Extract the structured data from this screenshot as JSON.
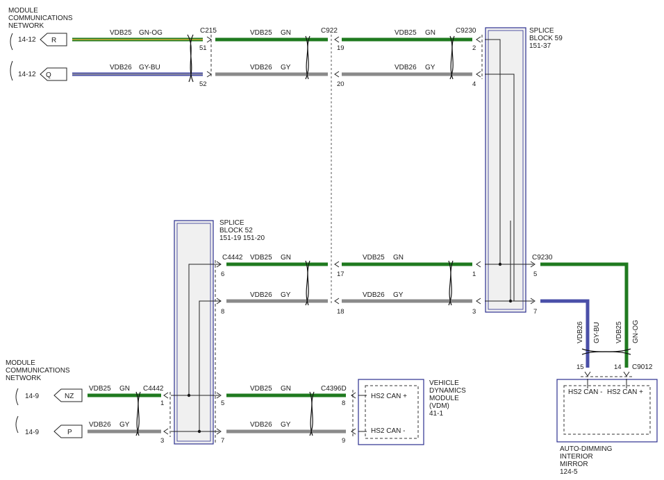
{
  "networks": {
    "top_title": [
      "MODULE",
      "COMMUNICATIONS",
      "NETWORK"
    ],
    "bottom_title": [
      "MODULE",
      "COMMUNICATIONS",
      "NETWORK"
    ],
    "top_refs": [
      "14-12",
      "14-12"
    ],
    "bottom_refs": [
      "14-9",
      "14-9"
    ],
    "top_tags": [
      "R",
      "Q"
    ],
    "bottom_tags": [
      "NZ",
      "P"
    ]
  },
  "wires": {
    "vdb25_gnog": [
      "VDB25",
      "GN-OG"
    ],
    "vdb26_gybu": [
      "VDB26",
      "GY-BU"
    ],
    "vdb25_gn": [
      "VDB25",
      "GN"
    ],
    "vdb26_gy": [
      "VDB26",
      "GY"
    ]
  },
  "connectors": {
    "c215": "C215",
    "c922": "C922",
    "c9230_top": "C9230",
    "c9230_right": "C9230",
    "c4442_mid": "C4442",
    "c4442_bot": "C4442",
    "c4396d": "C4396D",
    "c9012": "C9012"
  },
  "pins": {
    "p51": "51",
    "p52": "52",
    "p19": "19",
    "p20": "20",
    "p2": "2",
    "p4": "4",
    "p6": "6",
    "p8": "8",
    "p17": "17",
    "p18": "18",
    "p1a": "1",
    "p3a": "3",
    "p5r": "5",
    "p7r": "7",
    "p15": "15",
    "p14": "14",
    "p1b": "1",
    "p3b": "3",
    "p5": "5",
    "p7": "7",
    "p8b": "8",
    "p9": "9"
  },
  "splice59": {
    "lines": [
      "SPLICE",
      "BLOCK 59",
      "151-37"
    ]
  },
  "splice52": {
    "lines": [
      "SPLICE",
      "BLOCK 52",
      "151-19  151-20"
    ]
  },
  "vdm": {
    "lines": [
      "VEHICLE",
      "DYNAMICS",
      "MODULE",
      "(VDM)",
      "41-1"
    ],
    "pin_hi": "HS2 CAN +",
    "pin_lo": "HS2 CAN -"
  },
  "mirror": {
    "lines": [
      "AUTO-DIMMING",
      "INTERIOR",
      "MIRROR",
      "124-5"
    ],
    "pin_lo": "HS2 CAN -",
    "pin_hi": "HS2 CAN +"
  },
  "colors": {
    "green": "#1f7a1f",
    "gray": "#8a8a8a",
    "blue": "#4a4fa8",
    "box_border": "#2b2f8f"
  }
}
